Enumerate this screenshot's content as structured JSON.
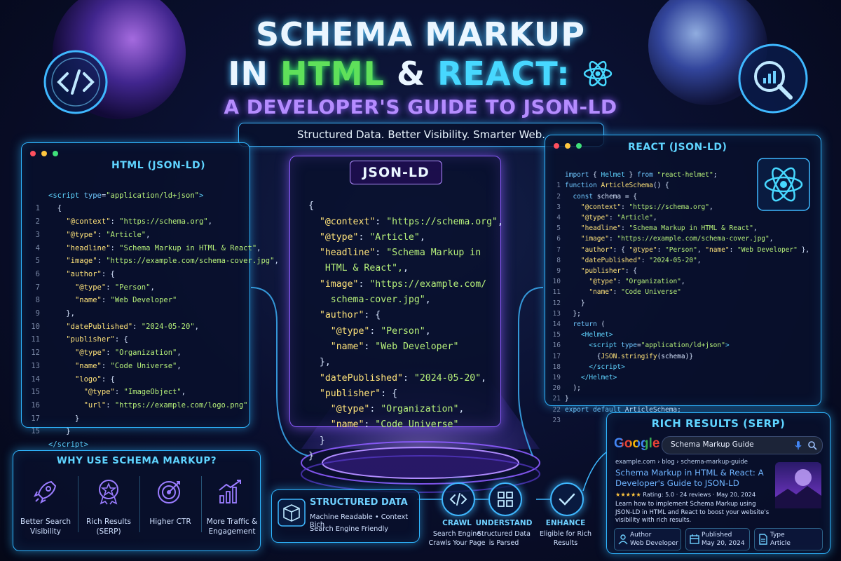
{
  "header": {
    "title_line1": "SCHEMA MARKUP",
    "title_in": "IN",
    "title_html": "HTML",
    "title_amp": "&",
    "title_react": "REACT:",
    "subtitle": "A DEVELOPER'S GUIDE TO JSON-LD",
    "tagline": "Structured Data. Better Visibility. Smarter Web."
  },
  "html_panel": {
    "title": "HTML (JSON-LD)",
    "line_numbers": [
      "1",
      "2",
      "3",
      "4",
      "5",
      "6",
      "7",
      "8",
      "9",
      "10",
      "11",
      "12",
      "13",
      "14",
      "15",
      "16",
      "17",
      "15"
    ]
  },
  "json_panel": {
    "title": "JSON-LD"
  },
  "react_panel": {
    "title": "REACT (JSON-LD)",
    "line_numbers": [
      "1",
      "2",
      "3",
      "4",
      "5",
      "6",
      "7",
      "8",
      "9",
      "10",
      "11",
      "12",
      "13",
      "14",
      "15",
      "16",
      "17",
      "18",
      "19",
      "20",
      "21",
      "22",
      "23"
    ]
  },
  "why": {
    "title": "WHY USE SCHEMA MARKUP?",
    "items": [
      {
        "label": "Better Search Visibility",
        "icon": "rocket-icon"
      },
      {
        "label": "Rich Results (SERP)",
        "icon": "star-badge-icon"
      },
      {
        "label": "Higher CTR",
        "icon": "target-icon"
      },
      {
        "label": "More Traffic & Engagement",
        "icon": "growth-chart-icon"
      }
    ]
  },
  "structured": {
    "title": "STRUCTURED DATA",
    "line1": "Machine Readable • Context Rich",
    "line2": "Search Engine Friendly"
  },
  "flow": [
    {
      "title": "CRAWL",
      "desc": "Search Engine Crawls Your Page",
      "icon": "code-icon"
    },
    {
      "title": "UNDERSTAND",
      "desc": "Structured Data is Parsed",
      "icon": "grid-icon"
    },
    {
      "title": "ENHANCE",
      "desc": "Eligible for Rich Results",
      "icon": "check-icon"
    }
  ],
  "serp": {
    "title": "RICH RESULTS (SERP)",
    "logo": "Google",
    "query": "Schema Markup Guide",
    "breadcrumb": "example.com › blog › schema-markup-guide",
    "result_title": "Schema Markup in HTML & React: A Developer's Guide to JSON-LD",
    "stars": "★★★★★",
    "rating_text": "Rating: 5.0 · 24 reviews · May 20, 2024",
    "snippet": "Learn how to implement Schema Markup using JSON-LD in HTML and React to boost your website's visibility with rich results.",
    "chips": [
      {
        "label": "Author",
        "value": "Web Developer",
        "icon": "person-icon"
      },
      {
        "label": "Published",
        "value": "May 20, 2024",
        "icon": "calendar-icon"
      },
      {
        "label": "Type",
        "value": "Article",
        "icon": "document-icon"
      }
    ]
  },
  "colors": {
    "accent_blue": "#2fb6ff",
    "accent_purple": "#8d5cff",
    "html_green": "#5fe05a",
    "react_cyan": "#47d8ff"
  }
}
